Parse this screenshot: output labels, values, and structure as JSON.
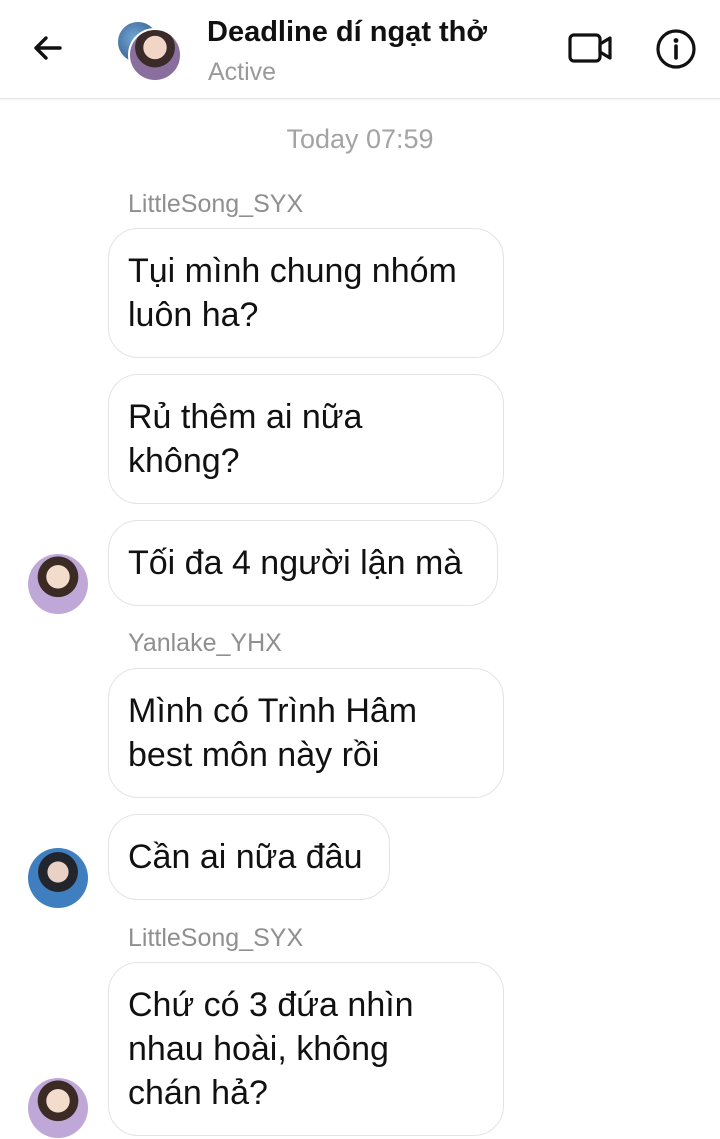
{
  "header": {
    "title": "Deadline dí ngạt thở",
    "status": "Active"
  },
  "timestamp": "Today 07:59",
  "messages": [
    {
      "sender": "LittleSong_SYX"
    },
    {
      "text": "Tụi mình chung nhóm\nluôn ha?"
    },
    {
      "text": "Rủ thêm ai nữa\nkhông?"
    },
    {
      "text": "Tối đa 4 người lận mà"
    },
    {
      "sender": "Yanlake_YHX"
    },
    {
      "text": "Mình có Trình Hâm\nbest môn này rồi"
    },
    {
      "text": "Cần ai nữa đâu"
    },
    {
      "sender": "LittleSong_SYX"
    },
    {
      "text": "Chứ có 3 đứa nhìn\nnhau hoài, không\nchán hả?"
    }
  ],
  "colors": {
    "bubble_border": "#e3e3e3",
    "muted_text": "#9a9a9a"
  },
  "icons": [
    "back-arrow-icon",
    "video-call-icon",
    "info-icon"
  ]
}
